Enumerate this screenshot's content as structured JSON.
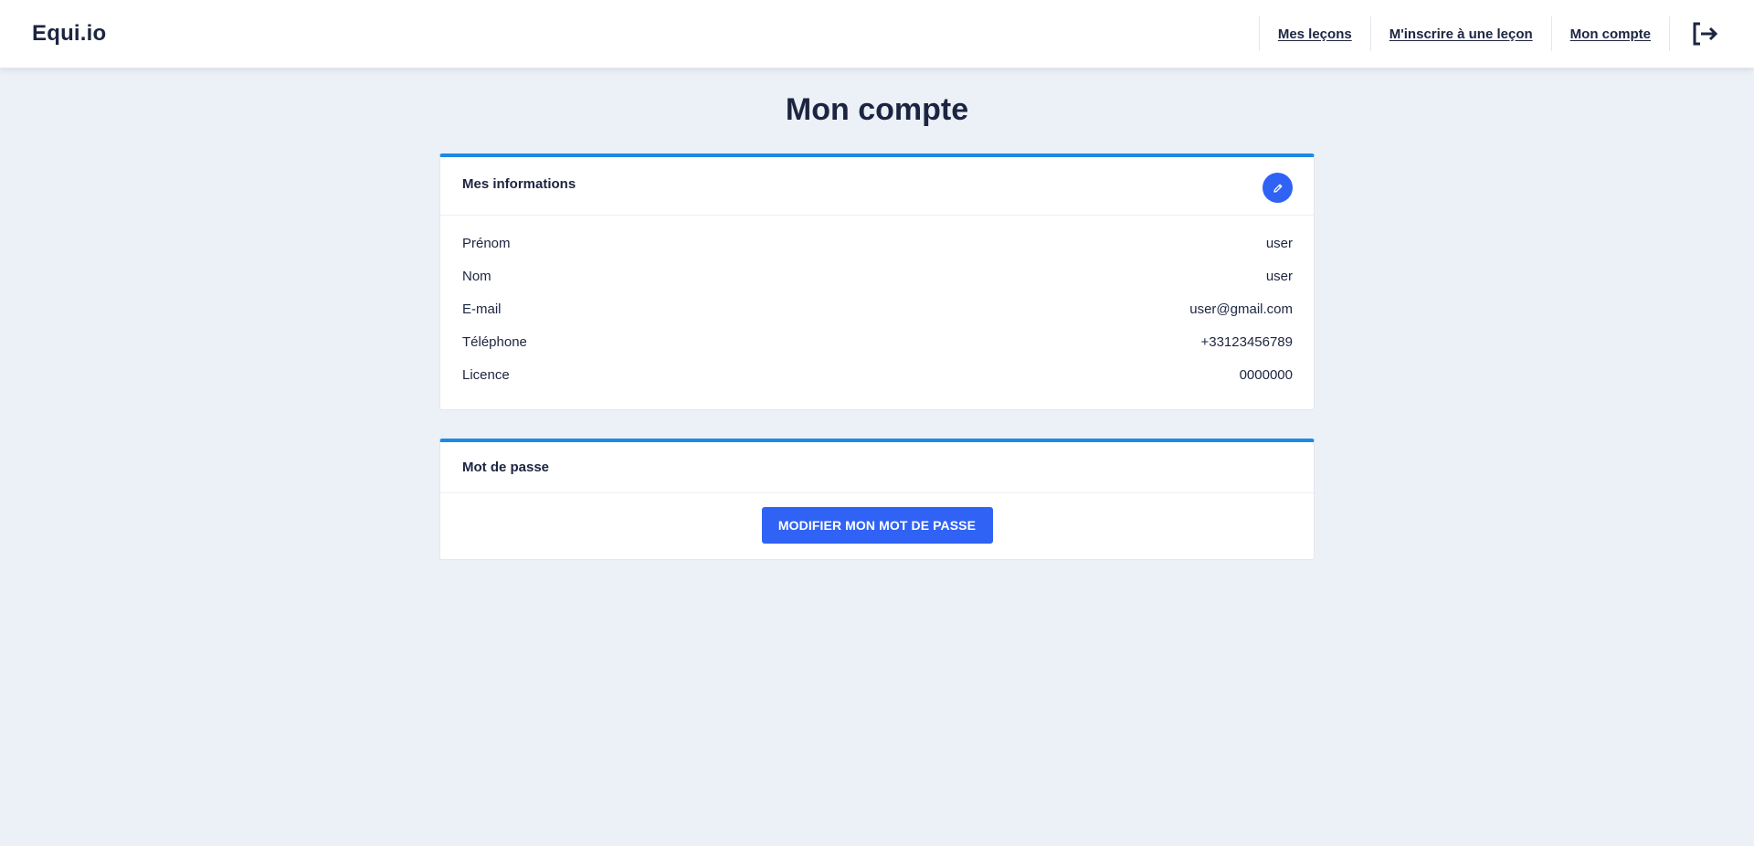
{
  "brand": "Equi.io",
  "nav": {
    "links": [
      "Mes leçons",
      "M'inscrire à une leçon",
      "Mon compte"
    ],
    "logout_icon": "logout-icon"
  },
  "page_title": "Mon compte",
  "info_card": {
    "title": "Mes informations",
    "edit_icon": "pencil-icon",
    "rows": [
      {
        "label": "Prénom",
        "value": "user"
      },
      {
        "label": "Nom",
        "value": "user"
      },
      {
        "label": "E-mail",
        "value": "user@gmail.com"
      },
      {
        "label": "Téléphone",
        "value": "+33123456789"
      },
      {
        "label": "Licence",
        "value": "0000000"
      }
    ]
  },
  "password_card": {
    "title": "Mot de passe",
    "button_label": "MODIFIER MON MOT DE PASSE"
  },
  "colors": {
    "accent": "#2f62f5",
    "card_border_top": "#1e88e5",
    "background": "#ecf0f7",
    "text": "#1c2540"
  }
}
